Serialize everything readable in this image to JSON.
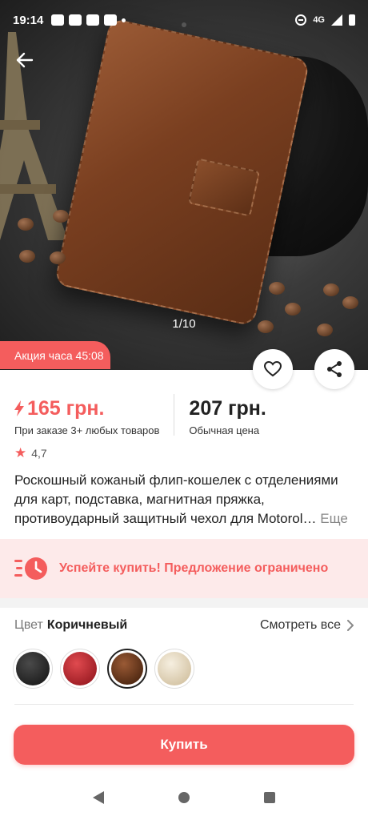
{
  "status_bar": {
    "time": "19:14",
    "network": "4G"
  },
  "hero": {
    "pager": "1/10"
  },
  "promo": {
    "tag": "Акция часа 45:08"
  },
  "prices": {
    "promo_price": "165 грн.",
    "promo_note": "При заказе 3+ любых товаров",
    "regular_price": "207 грн.",
    "regular_note": "Обычная цена"
  },
  "rating": {
    "value": "4,7"
  },
  "description": {
    "text": "Роскошный кожаный флип-кошелек с отделениями для карт, подставка, магнитная пряжка, противоударный защитный чехол для Motorol…",
    "more": "Еще"
  },
  "urgency": {
    "text": "Успейте купить! Предложение ограничено"
  },
  "color_selector": {
    "label": "Цвет",
    "value": "Коричневый",
    "see_all": "Смотреть все",
    "swatches": [
      {
        "name": "black",
        "color": "#1a1a1a"
      },
      {
        "name": "red",
        "color": "#c4212b"
      },
      {
        "name": "brown",
        "color": "#6b3518"
      },
      {
        "name": "beige",
        "color": "#e8dcc2"
      }
    ]
  },
  "buy": {
    "label": "Купить"
  },
  "colors": {
    "accent": "#f45d5d",
    "urgency_bg": "#fdeaea"
  }
}
